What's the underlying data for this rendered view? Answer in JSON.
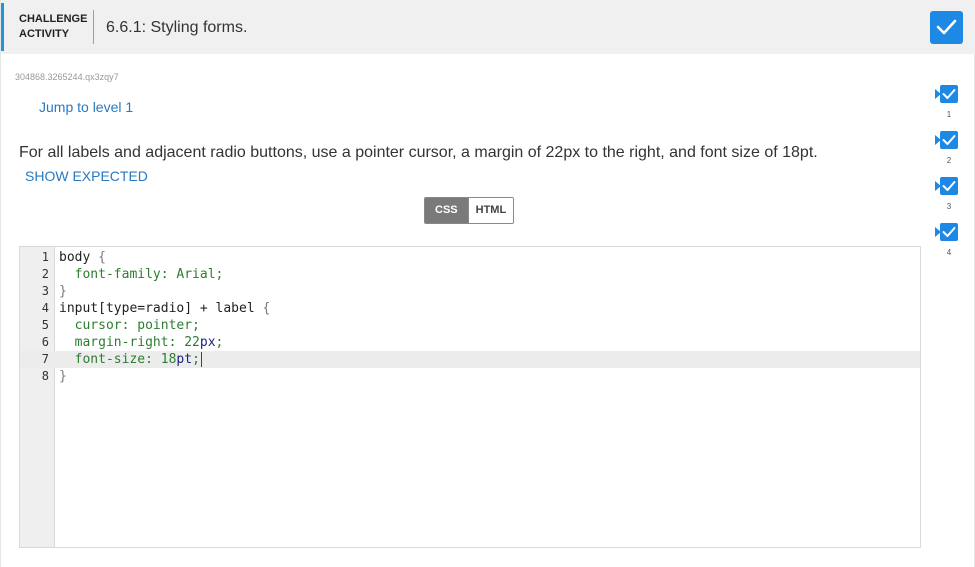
{
  "header": {
    "activity_label": "CHALLENGE\nACTIVITY",
    "title": "6.6.1: Styling forms.",
    "completed_icon": "checkmark-icon"
  },
  "challenge_id": "304868.3265244.qx3zqy7",
  "jump_link": "Jump to level 1",
  "instructions": "For all labels and adjacent radio buttons, use a pointer cursor, a margin of 22px to the right, and font size of 18pt.",
  "show_expected": "SHOW EXPECTED",
  "tabs": [
    {
      "label": "CSS",
      "active": true
    },
    {
      "label": "HTML",
      "active": false
    }
  ],
  "editor": {
    "lines": [
      {
        "no": "1",
        "parts": [
          {
            "t": "body ",
            "c": "sel"
          },
          {
            "t": "{",
            "c": "br"
          }
        ]
      },
      {
        "no": "2",
        "parts": [
          {
            "t": "  font-family: Arial;",
            "c": "prop"
          }
        ]
      },
      {
        "no": "3",
        "parts": [
          {
            "t": "}",
            "c": "br"
          }
        ]
      },
      {
        "no": "4",
        "parts": [
          {
            "t": "input[type=radio] + label ",
            "c": "sel"
          },
          {
            "t": "{",
            "c": "br"
          }
        ]
      },
      {
        "no": "5",
        "parts": [
          {
            "t": "  cursor: pointer;",
            "c": "prop"
          }
        ]
      },
      {
        "no": "6",
        "parts": [
          {
            "t": "  margin-right: 22",
            "c": "prop"
          },
          {
            "t": "px",
            "c": "num"
          },
          {
            "t": ";",
            "c": "prop"
          }
        ]
      },
      {
        "no": "7",
        "parts": [
          {
            "t": "  font-size: 18",
            "c": "prop"
          },
          {
            "t": "pt",
            "c": "num"
          },
          {
            "t": ";",
            "c": "prop"
          }
        ],
        "current": true
      },
      {
        "no": "8",
        "parts": [
          {
            "t": "}",
            "c": "br"
          }
        ]
      }
    ]
  },
  "levels": [
    {
      "number": "1",
      "status": "completed"
    },
    {
      "number": "2",
      "status": "completed"
    },
    {
      "number": "3",
      "status": "completed"
    },
    {
      "number": "4",
      "status": "completed"
    }
  ],
  "colors": {
    "accent": "#1e88e5",
    "link": "#2979c2",
    "tab_active": "#7a7a7a"
  }
}
